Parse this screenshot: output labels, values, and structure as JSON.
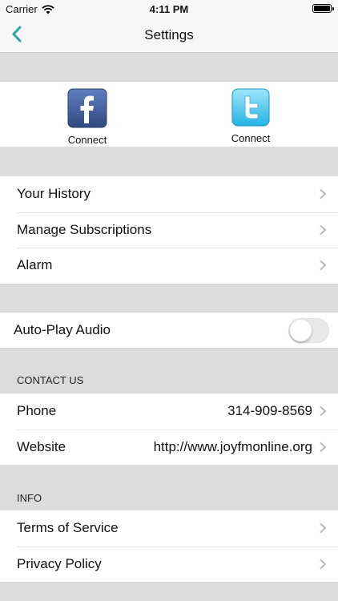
{
  "status": {
    "carrier": "Carrier",
    "time": "4:11 PM"
  },
  "nav": {
    "title": "Settings",
    "accent": "#2aa9a4"
  },
  "social": {
    "facebook": {
      "label": "Connect",
      "color": "#3b5998"
    },
    "twitter": {
      "label": "Connect",
      "color": "#33ccff"
    }
  },
  "group1": [
    {
      "label": "Your History"
    },
    {
      "label": "Manage Subscriptions"
    },
    {
      "label": "Alarm"
    }
  ],
  "autoplay": {
    "label": "Auto-Play Audio",
    "enabled": false
  },
  "contact": {
    "header": "CONTACT US",
    "rows": [
      {
        "label": "Phone",
        "value": "314-909-8569"
      },
      {
        "label": "Website",
        "value": "http://www.joyfmonline.org"
      }
    ]
  },
  "info": {
    "header": "INFO",
    "rows": [
      {
        "label": "Terms of Service"
      },
      {
        "label": "Privacy Policy"
      }
    ]
  }
}
